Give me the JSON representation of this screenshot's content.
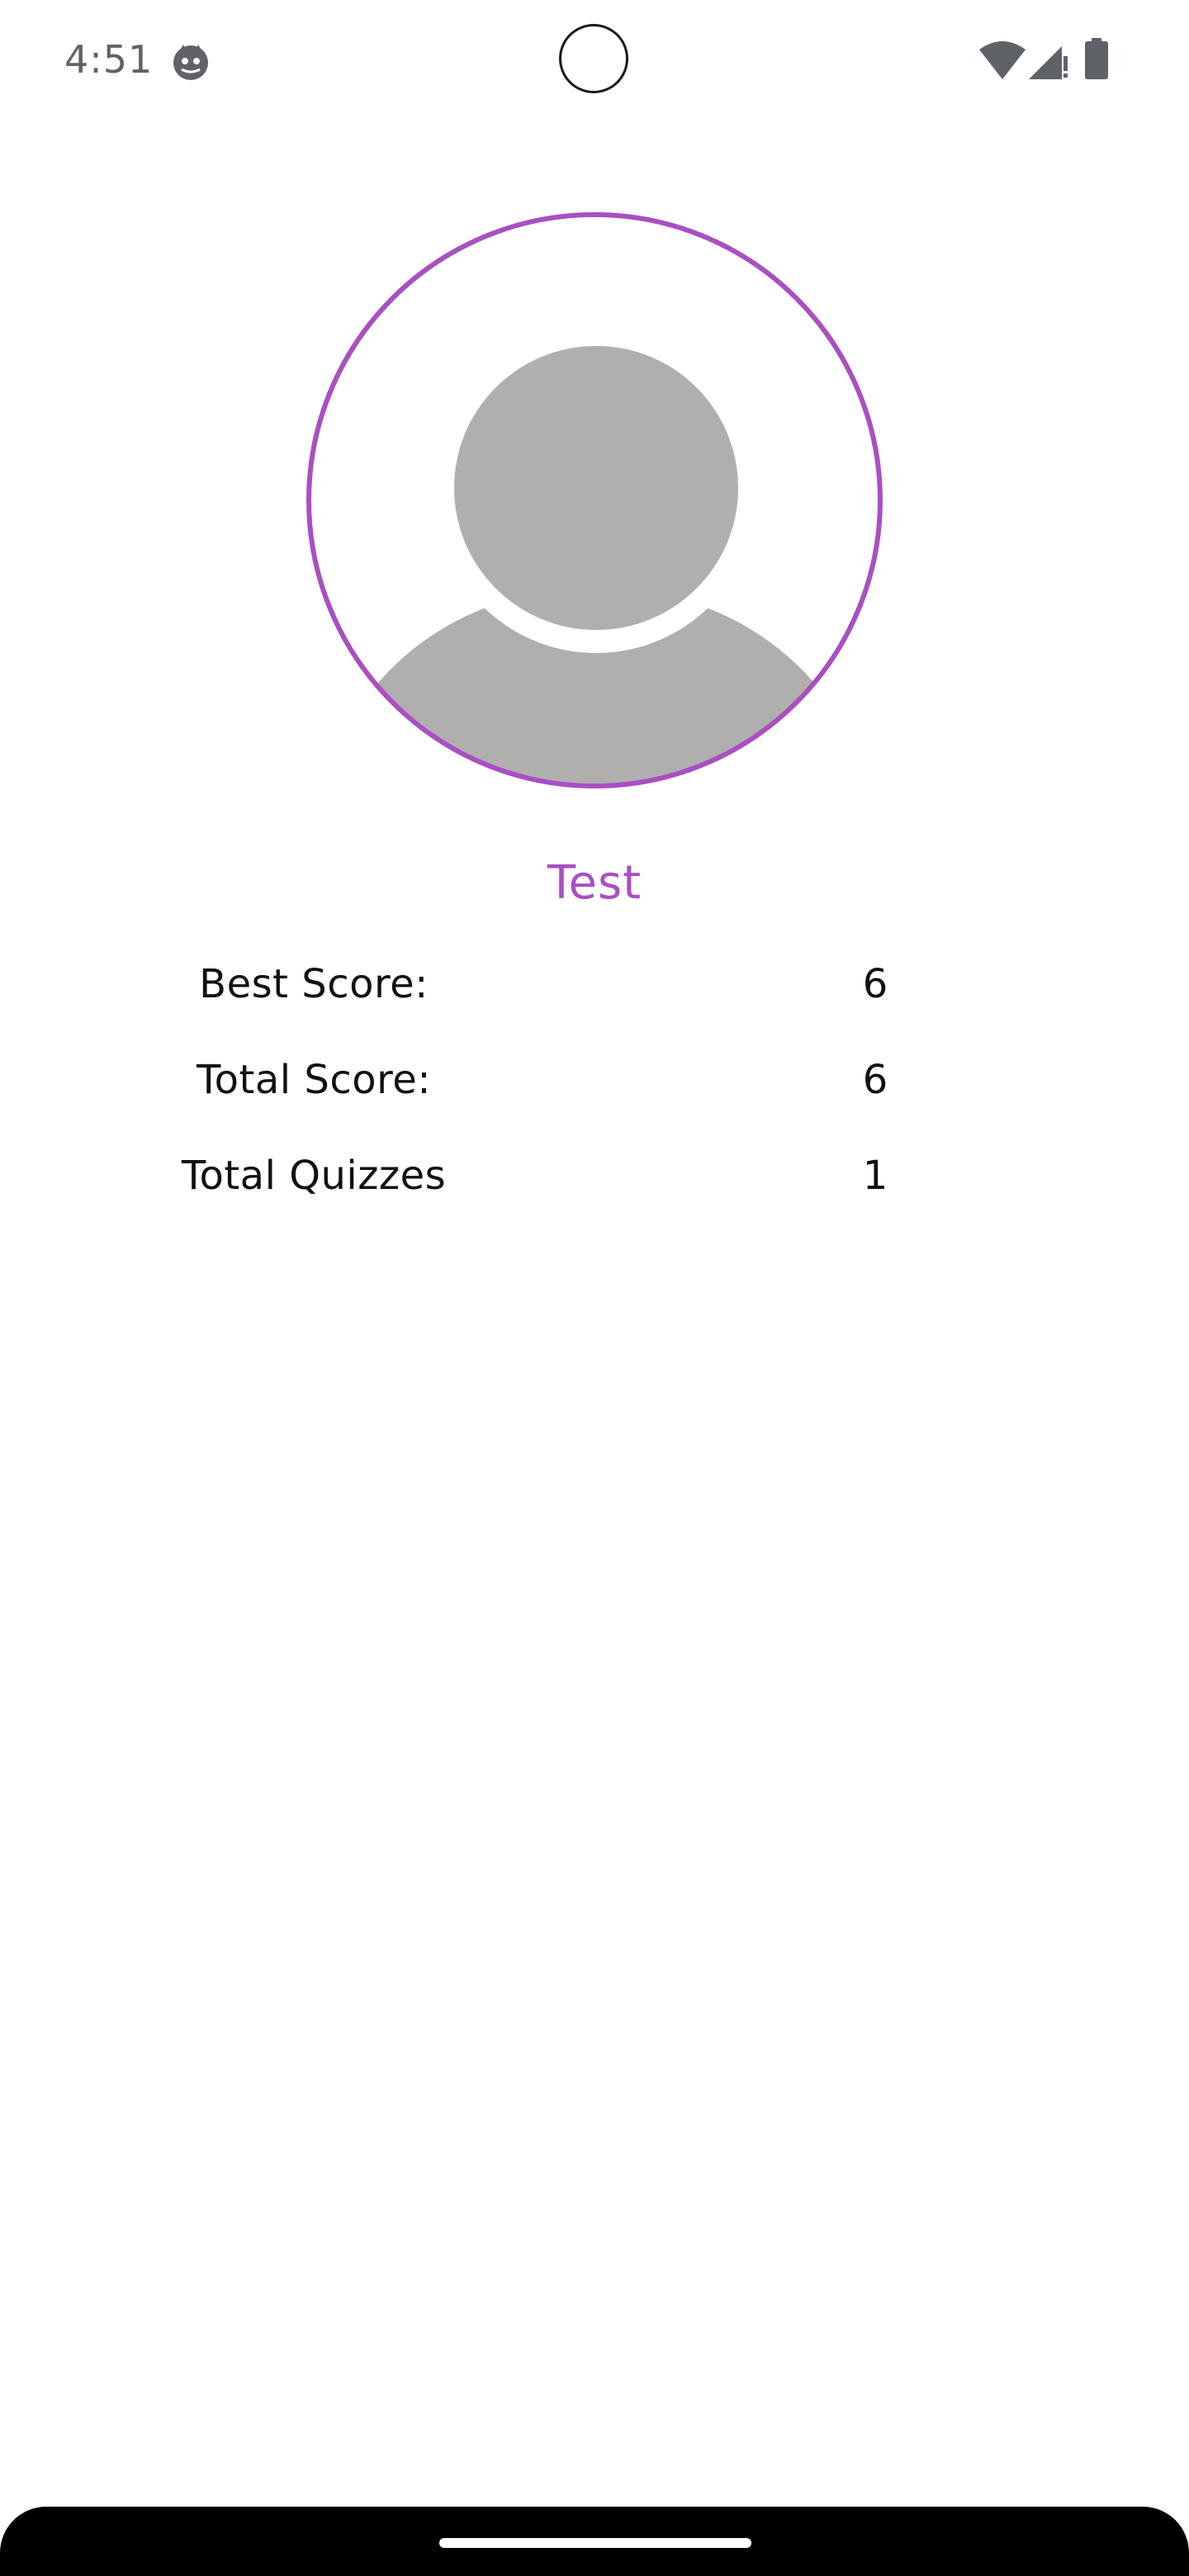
{
  "status_bar": {
    "time": "4:51",
    "icons": [
      "cat-face-icon",
      "wifi-icon",
      "cellular-signal-icon",
      "battery-icon"
    ]
  },
  "colors": {
    "accent": "#a94fc2",
    "avatar_gray": "#b0afae",
    "text": "#111111",
    "status_text": "#5f6368"
  },
  "profile": {
    "username": "Test"
  },
  "stats": [
    {
      "label": "Best Score:",
      "value": "6"
    },
    {
      "label": "Total Score:",
      "value": "6"
    },
    {
      "label": "Total Quizzes",
      "value": "1"
    }
  ]
}
